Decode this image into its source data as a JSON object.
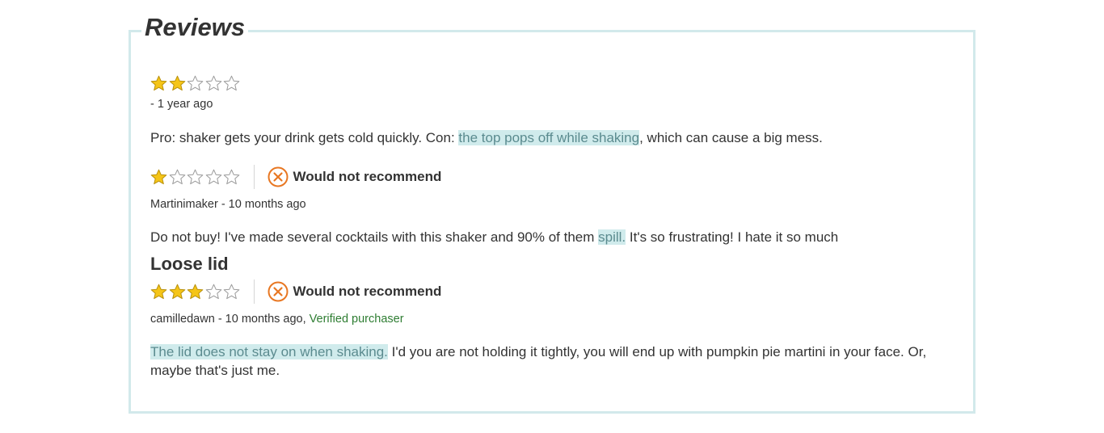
{
  "heading": "Reviews",
  "colors": {
    "border": "#d2e9eb",
    "highlight_bg": "#d0ebec",
    "highlight_text": "#5b8b8f",
    "star_fill": "#f5c518",
    "not_recommend": "#e87722",
    "verified": "#2e7d32"
  },
  "reviews": [
    {
      "rating": 2,
      "max_rating": 5,
      "meta": "- 1 year ago",
      "text_before": "Pro: shaker gets your drink gets cold quickly. Con: ",
      "highlight": "the top pops off while shaking",
      "text_after": ", which can cause a big mess."
    },
    {
      "rating": 1,
      "max_rating": 5,
      "recommend_icon": "x-circle-icon",
      "recommend_label": "Would not recommend",
      "meta": "Martinimaker - 10 months ago",
      "text_before": "Do not buy! I've made several cocktails with this shaker and 90% of them ",
      "highlight": "spill.",
      "text_after": " It's so frustrating! I hate it so much"
    },
    {
      "title": "Loose lid",
      "rating": 3,
      "max_rating": 5,
      "recommend_icon": "x-circle-icon",
      "recommend_label": "Would not recommend",
      "meta": "camilledawn - 10 months ago, ",
      "verified": "Verified purchaser",
      "text_before": "",
      "highlight": "The lid does not stay on when shaking.",
      "text_after": " I'd you are not holding it tightly, you will end up with pumpkin pie martini in your face. Or, maybe that's just me."
    }
  ]
}
